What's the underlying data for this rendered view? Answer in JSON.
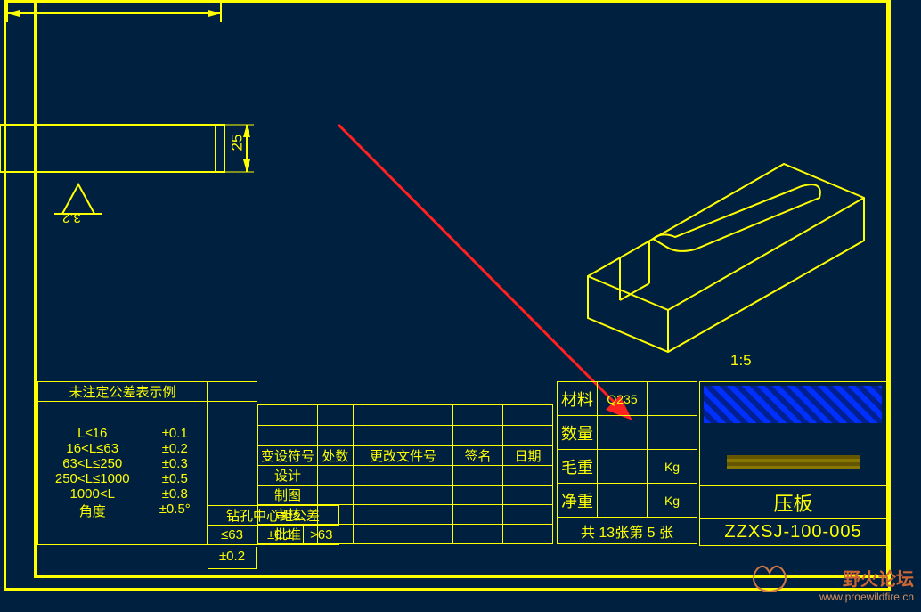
{
  "drawing": {
    "dimension_height": "25",
    "surface_finish": "3.2",
    "scale_iso": "1:5"
  },
  "tolerance": {
    "header": "未注定公差表示例",
    "rows": [
      {
        "range": "L≤16",
        "tol": "±0.1"
      },
      {
        "range": "16<L≤63",
        "tol": "±0.2"
      },
      {
        "range": "63<L≤250",
        "tol": "±0.3"
      },
      {
        "range": "250<L≤1000",
        "tol": "±0.5"
      },
      {
        "range": "1000<L",
        "tol": "±0.8"
      },
      {
        "range": "角度",
        "tol": "±0.5°"
      }
    ],
    "hole_label": "钻孔中心距公差",
    "hole_a": "≤63",
    "hole_a_tol": "±0.1",
    "hole_b": ">63",
    "hole_b_tol": "±0.2"
  },
  "revision": {
    "h1": "变设符号",
    "h2": "处数",
    "h3": "更改文件号",
    "h4": "签名",
    "h5": "日期",
    "r1": "设计",
    "r2": "制图",
    "r3": "审核",
    "r4": "批准"
  },
  "title": {
    "material_label": "材料",
    "material_value": "Q235",
    "qty_label": "数量",
    "gross_label": "毛重",
    "gross_unit": "Kg",
    "net_label": "净重",
    "net_unit": "Kg",
    "sheet_info_pre": "共",
    "sheet_total": "13",
    "sheet_mid": "张第",
    "sheet_num": "5",
    "sheet_post": "张",
    "part_name": "压板",
    "drawing_no": "ZZXSJ-100-005"
  },
  "watermark": {
    "line1": "野火论坛",
    "line2": "www.proewildfire.cn"
  },
  "arrow": {
    "title": "指示箭头指向数量栏"
  }
}
